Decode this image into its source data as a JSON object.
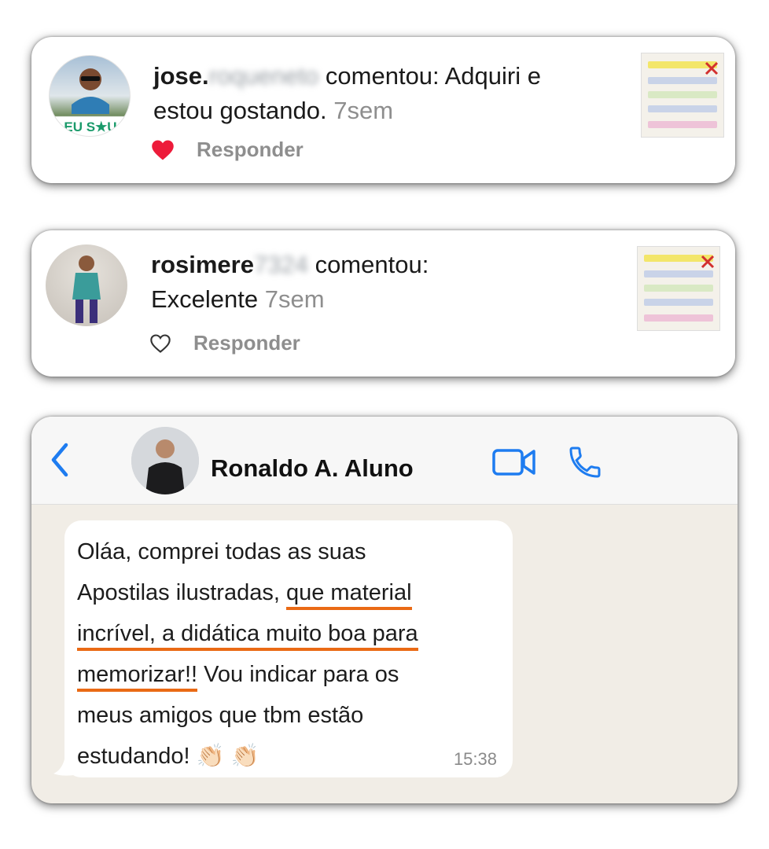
{
  "comments": [
    {
      "username_visible": "jose.",
      "username_blurred": "roqueneto",
      "verb": "comentou:",
      "line1_text": "Adquiri e",
      "line2_text": "estou gostando.",
      "time": "7sem",
      "liked": true,
      "reply_label": "Responder",
      "avatar_badge": "EU S★U"
    },
    {
      "username_visible": "rosimere",
      "username_blurred": "7324",
      "verb": "comentou:",
      "line2_text": "Excelente",
      "time": "7sem",
      "liked": false,
      "reply_label": "Responder"
    }
  ],
  "chat": {
    "contact_name": "Ronaldo A. Aluno",
    "message_lines": [
      {
        "before": "Oláa, comprei todas as suas",
        "underlined": "",
        "after": ""
      },
      {
        "before": "Apostilas ilustradas, ",
        "underlined": "que material",
        "after": ""
      },
      {
        "before": "",
        "underlined": "incrível, a didática muito boa para",
        "after": ""
      },
      {
        "before": "",
        "underlined": "memorizar!!",
        "after": " Vou indicar para os"
      },
      {
        "before": "meus amigos que tbm estão",
        "underlined": "",
        "after": ""
      },
      {
        "before": "estudando! 👏🏻 👏🏻",
        "underlined": "",
        "after": ""
      }
    ],
    "time": "15:38"
  },
  "colors": {
    "like_red": "#ed1b3a",
    "accent_blue": "#1e7cf0",
    "underline_orange": "#ea6a15",
    "chat_background": "#f1ede6"
  }
}
